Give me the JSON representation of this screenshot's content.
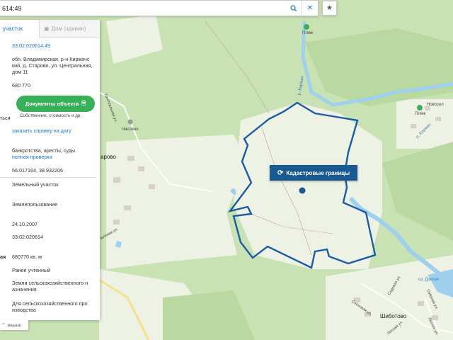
{
  "search": {
    "value": "614:49"
  },
  "panel": {
    "tabs": [
      {
        "label": "участок"
      },
      {
        "label": "Дом (здание)"
      }
    ],
    "cadastral_number": "33:02:020614:49",
    "address": [
      "обл. Владимирская, р-н Киржачс",
      "кий, д. Старово, ул. Центральная,",
      "дом 11"
    ],
    "cost": "680 770",
    "left_cut": "ться",
    "documents_button": "Документы объекта",
    "documents_sub": "Собственник, стоимость и др.",
    "order_link": "заказать справку на дату",
    "check_text": "банкротства, аресты, суды",
    "check_link": "полная проверка",
    "coords": "56.017164, 38.932206",
    "type": "Земельный участок",
    "category": "Землепользование",
    "date": "24.10.2007",
    "quarter": "33:02:020614",
    "area_label": "ая",
    "area": "680770 кв. м",
    "status": "Ранее учтенный",
    "land_category": [
      "Земли сельскохозяйственного н",
      "азначения"
    ],
    "usage": [
      "Для сельскохозяйственного про",
      "изводства"
    ],
    "less_label": "еньше"
  },
  "map": {
    "cadastral_button": "Кадастровые границы",
    "labels": {
      "beach1": "Пляж",
      "beach2": "Пляж",
      "chapel": "Часовня",
      "starovo": "арово",
      "novoselovo": "Новосел",
      "shibotovo": "Шиботово",
      "lake": "оз. Долгое",
      "river1": "р. Киржач",
      "river2": "р. Киржач",
      "street1": "Центральная ул.",
      "street2": "Полевая ул.",
      "street3": "Садовая ул.",
      "street4": "Лесная ул.",
      "street5": "Озёрная ул.",
      "street6": "Сосновая ул.",
      "street7": "Лесная ул."
    }
  },
  "colors": {
    "boundary": "#1a5ba6",
    "river": "#9fd0ee",
    "forest": "#c9e2b3",
    "field": "#eef2e5",
    "button": "#38b05a",
    "cad_button": "#1a5a92"
  }
}
